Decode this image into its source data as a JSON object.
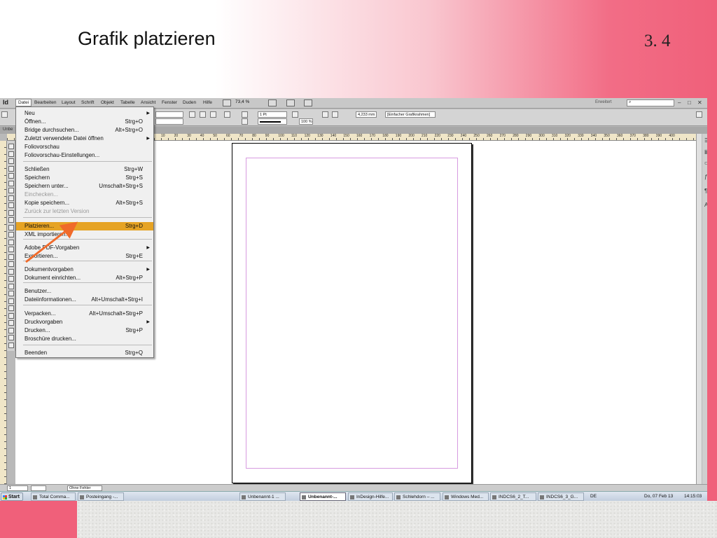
{
  "slide": {
    "title": "Grafik platzieren",
    "number": "3. 4"
  },
  "app": {
    "logo": "Id",
    "menu": [
      "Datei",
      "Bearbeiten",
      "Layout",
      "Schrift",
      "Objekt",
      "Tabelle",
      "Ansicht",
      "Fenster",
      "Duden",
      "Hilfe"
    ],
    "active_menu": "Datei",
    "zoom": "73,4 %",
    "workspace": "Erweitert",
    "control": {
      "stroke_weight": "1 Pt",
      "width_value": "4,233 mm",
      "frame_style": "[Einfacher Grafikrahmen]",
      "scale_value": "100 %"
    },
    "doc_tab": "Unbe",
    "ruler_labels": [
      "10",
      "20",
      "30",
      "40",
      "50",
      "60",
      "70",
      "80",
      "90",
      "100",
      "110",
      "120",
      "130",
      "140",
      "150",
      "160",
      "170",
      "180",
      "190",
      "200",
      "210",
      "220",
      "230",
      "240",
      "250",
      "260",
      "270",
      "280",
      "290",
      "300",
      "310",
      "320",
      "330",
      "340",
      "350",
      "360",
      "370",
      "380",
      "390",
      "400"
    ],
    "status": {
      "page": "1",
      "preflight": "Ohne Fehler"
    }
  },
  "file_menu": {
    "items": [
      {
        "label": "Neu",
        "shortcut": "",
        "submenu": true,
        "disabled": false
      },
      {
        "label": "Öffnen...",
        "shortcut": "Strg+O",
        "submenu": false,
        "disabled": false
      },
      {
        "label": "Bridge durchsuchen...",
        "shortcut": "Alt+Strg+O",
        "submenu": false,
        "disabled": false
      },
      {
        "label": "Zuletzt verwendete Datei öffnen",
        "shortcut": "",
        "submenu": true,
        "disabled": false
      },
      {
        "label": "Foliovorschau",
        "shortcut": "",
        "submenu": false,
        "disabled": false
      },
      {
        "label": "Foliovorschau-Einstellungen...",
        "shortcut": "",
        "submenu": false,
        "disabled": false
      },
      {
        "label": "Schließen",
        "shortcut": "Strg+W",
        "submenu": false,
        "disabled": false
      },
      {
        "label": "Speichern",
        "shortcut": "Strg+S",
        "submenu": false,
        "disabled": false
      },
      {
        "label": "Speichern unter...",
        "shortcut": "Umschalt+Strg+S",
        "submenu": false,
        "disabled": false
      },
      {
        "label": "Einchecken...",
        "shortcut": "",
        "submenu": false,
        "disabled": true
      },
      {
        "label": "Kopie speichern...",
        "shortcut": "Alt+Strg+S",
        "submenu": false,
        "disabled": false
      },
      {
        "label": "Zurück zur letzten Version",
        "shortcut": "",
        "submenu": false,
        "disabled": true
      },
      {
        "label": "Platzieren...",
        "shortcut": "Strg+D",
        "submenu": false,
        "disabled": false,
        "highlight": true
      },
      {
        "label": "XML importieren...",
        "shortcut": "",
        "submenu": false,
        "disabled": false
      },
      {
        "label": "Adobe PDF-Vorgaben",
        "shortcut": "",
        "submenu": true,
        "disabled": false
      },
      {
        "label": "Exportieren...",
        "shortcut": "Strg+E",
        "submenu": false,
        "disabled": false
      },
      {
        "label": "Dokumentvorgaben",
        "shortcut": "",
        "submenu": true,
        "disabled": false
      },
      {
        "label": "Dokument einrichten...",
        "shortcut": "Alt+Strg+P",
        "submenu": false,
        "disabled": false
      },
      {
        "label": "Benutzer...",
        "shortcut": "",
        "submenu": false,
        "disabled": false
      },
      {
        "label": "Dateiinformationen...",
        "shortcut": "Alt+Umschalt+Strg+I",
        "submenu": false,
        "disabled": false
      },
      {
        "label": "Verpacken...",
        "shortcut": "Alt+Umschalt+Strg+P",
        "submenu": false,
        "disabled": false
      },
      {
        "label": "Druckvorgaben",
        "shortcut": "",
        "submenu": true,
        "disabled": false
      },
      {
        "label": "Drucken...",
        "shortcut": "Strg+P",
        "submenu": false,
        "disabled": false
      },
      {
        "label": "Broschüre drucken...",
        "shortcut": "",
        "submenu": false,
        "disabled": false
      },
      {
        "label": "Beenden",
        "shortcut": "Strg+Q",
        "submenu": false,
        "disabled": false
      }
    ]
  },
  "taskbar": {
    "start": "Start",
    "tasks": [
      "Total Comma...",
      "Posteingang -...",
      "Unbenannt-1 ...",
      "Unbenannt-...",
      "InDesign-Hilfe...",
      "Schlehdorn – ...",
      "Windows Med...",
      "INDCS6_2_T...",
      "INDCS6_3_G..."
    ],
    "active_task": "Unbenannt-...",
    "lang": "DE",
    "date": "Do, 07 Feb 13",
    "time": "14:15:03"
  },
  "colors": {
    "accent_pink": "#f0607a",
    "menu_highlight": "#e6a324",
    "arrow": "#f06a2a",
    "margin_guide": "#d79be0"
  },
  "icons": [
    "windows-logo-icon",
    "submenu-arrow-icon",
    "search-icon",
    "minimize-icon",
    "maximize-icon",
    "close-icon"
  ]
}
